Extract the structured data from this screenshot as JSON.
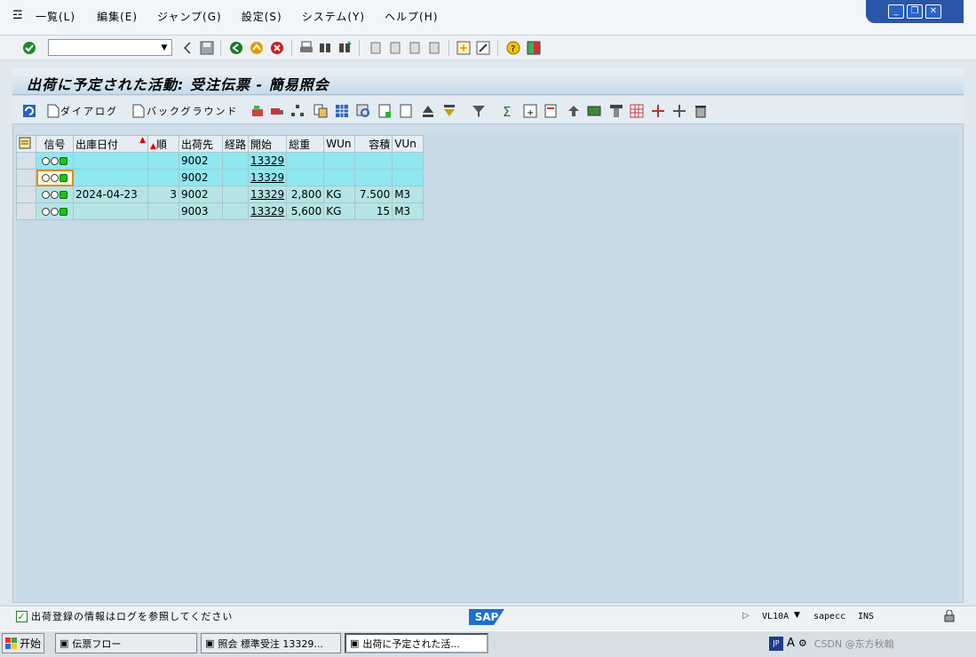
{
  "menubar": {
    "items": [
      "一覧(L)",
      "編集(E)",
      "ジャンプ(G)",
      "設定(S)",
      "システム(Y)",
      "ヘルプ(H)"
    ]
  },
  "toolbar": {
    "command_field_value": ""
  },
  "title": "出荷に予定された活動: 受注伝票 - 簡易照会",
  "app_toolbar": {
    "dialog_label": "ダイアログ",
    "background_label": "バックグラウンド"
  },
  "grid": {
    "columns": [
      "信号",
      "出庫日付",
      "順",
      "出荷先",
      "経路",
      "開始",
      "総重",
      "WUn",
      "容積",
      "VUn"
    ],
    "rows": [
      {
        "date": "",
        "seq": "",
        "ship_to": "9002",
        "route": "",
        "start": "13329",
        "weight": "",
        "wun": "",
        "volume": "",
        "vun": ""
      },
      {
        "date": "",
        "seq": "",
        "ship_to": "9002",
        "route": "",
        "start": "13329",
        "weight": "",
        "wun": "",
        "volume": "",
        "vun": ""
      },
      {
        "date": "2024-04-23",
        "seq": "3",
        "ship_to": "9002",
        "route": "",
        "start": "13329",
        "weight": "2,800",
        "wun": "KG",
        "volume": "7.500",
        "vun": "M3"
      },
      {
        "date": "",
        "seq": "",
        "ship_to": "9003",
        "route": "",
        "start": "13329",
        "weight": "5,600",
        "wun": "KG",
        "volume": "15",
        "vun": "M3"
      }
    ]
  },
  "status": {
    "message": "出荷登録の情報はログを参照してください",
    "logo": "SAP",
    "transaction": "VL10A",
    "server": "sapecc",
    "mode": "INS"
  },
  "taskbar": {
    "start_label": "开始",
    "tasks": [
      "伝票フロー",
      "照会 標準受注 13329...",
      "出荷に予定された活..."
    ],
    "lang": "JP",
    "watermark": "CSDN @东方秋翰"
  }
}
